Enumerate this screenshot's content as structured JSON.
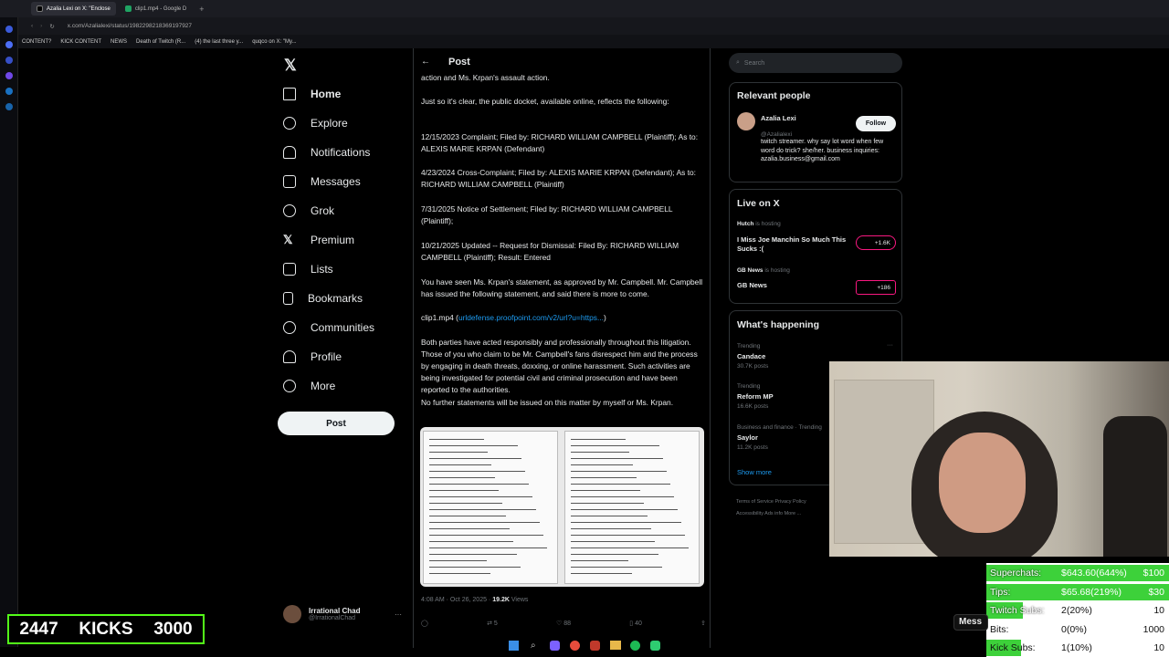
{
  "browser": {
    "tabs": [
      "Azalia Lexi on X: \"Enclose",
      "clip1.mp4 - Google D"
    ],
    "url": "x.com/Azalialexi/status/1982298218369197927",
    "bookmarks": [
      "CONTENT?",
      "KICK CONTENT",
      "NEWS",
      "Death of Twitch (R...",
      "(4) the last three y...",
      "quqco on X: \"My..."
    ]
  },
  "nav": {
    "items": [
      "Home",
      "Explore",
      "Notifications",
      "Messages",
      "Grok",
      "Premium",
      "Lists",
      "Bookmarks",
      "Communities",
      "Profile",
      "More"
    ],
    "post_button": "Post",
    "account_name": "Irrational Chad",
    "account_handle": "@IrrationalChad"
  },
  "post": {
    "header": "Post",
    "top_partial": "action and Ms. Krpan's assault action.",
    "p1": "Just so it's clear, the public docket, available online, reflects the following:",
    "p2": "12/15/2023  Complaint; Filed by: RICHARD WILLIAM CAMPBELL (Plaintiff); As to: ALEXIS MARIE KRPAN (Defendant)",
    "p3": "4/23/2024   Cross-Complaint; Filed by: ALEXIS MARIE KRPAN (Defendant); As to: RICHARD WILLIAM CAMPBELL (Plaintiff)",
    "p4": "7/31/2025   Notice of Settlement; Filed by: RICHARD WILLIAM CAMPBELL (Plaintiff);",
    "p5": "10/21/2025  Updated -- Request for Dismissal: Filed By: RICHARD WILLIAM CAMPBELL (Plaintiff); Result: Entered",
    "p6": "You have seen Ms. Krpan's statement, as approved by Mr. Campbell.  Mr. Campbell has issued the following statement, and said there is more to come.",
    "clip_label": "clip1.mp4 (",
    "clip_link": "urldefense.proofpoint.com/v2/url?u=https...",
    "clip_close": ")",
    "p7": "Both parties have acted responsibly and professionally throughout this litigation.  Those of you who claim to be Mr. Campbell's fans disrespect him and the process by engaging in death threats, doxxing, or online harassment.  Such activities are being investigated for potential civil and criminal prosecution and have been reported to the authorities.",
    "p8": "No further statements will be issued on this matter by myself or Ms. Krpan.",
    "meta_time": "4:08 AM · Oct 26, 2025 · ",
    "meta_views": "19.2K",
    "meta_views_label": " Views",
    "actions": {
      "retweets": "5",
      "likes": "88",
      "bookmarks": "40"
    }
  },
  "right": {
    "search_placeholder": "Search",
    "relevant_title": "Relevant people",
    "person_name": "Azalia Lexi",
    "person_handle": "@Azalialexi",
    "person_bio": "twitch streamer. why say lot word when few word do trick? she/her. business inquiries: azalia.business@gmail.com",
    "follow": "Follow",
    "live_title": "Live on X",
    "live1_host": "Hutch",
    "live1_status": "is hosting",
    "live1_title": "I Miss Joe Manchin So Much This Sucks :(",
    "live1_count": "+1.6K",
    "live2_host": "GB News",
    "live2_status": "is hosting",
    "live2_title": "GB News",
    "live2_count": "+186",
    "happening_title": "What's happening",
    "trends": [
      {
        "cat": "Trending",
        "name": "Candace",
        "posts": "30.7K posts"
      },
      {
        "cat": "Trending",
        "name": "Reform MP",
        "posts": "16.6K posts"
      },
      {
        "cat": "Business and finance · Trending",
        "name": "Saylor",
        "posts": "11.2K posts"
      }
    ],
    "show_more": "Show more",
    "footer": "Terms of Service   Privacy Policy   Accessibility   Ads info   More ..."
  },
  "overlay": {
    "kicks_count": "2447",
    "kicks_label": "KICKS",
    "kicks_goal": "3000",
    "stats": [
      {
        "label": "Superchats:",
        "mid": "$643.60(644%)",
        "right": "$100",
        "fill": 1.0
      },
      {
        "label": "Tips:",
        "mid": "$65.68(219%)",
        "right": "$30",
        "fill": 1.0
      },
      {
        "label": "Twitch Subs:",
        "mid": "2(20%)",
        "right": "10",
        "fill": 0.2
      },
      {
        "label": "Bits:",
        "mid": "0(0%)",
        "right": "1000",
        "fill": 0.0
      },
      {
        "label": "Kick Subs:",
        "mid": "1(10%)",
        "right": "10",
        "fill": 0.1
      }
    ],
    "messages_partial": "Mess"
  },
  "colors": {
    "accent": "#1d9bf0",
    "kick_green": "#53fc18",
    "bar_green": "#3dd13a"
  }
}
